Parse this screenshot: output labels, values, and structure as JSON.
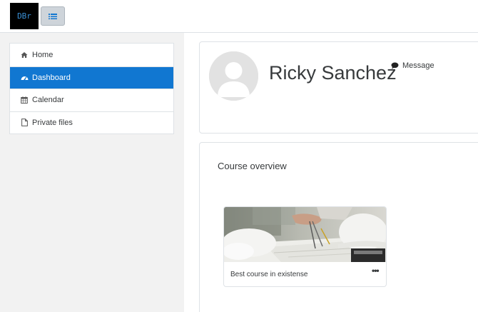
{
  "brand": {
    "logo_text": "DBr"
  },
  "sidebar": {
    "items": [
      {
        "label": "Home",
        "icon": "home-icon"
      },
      {
        "label": "Dashboard",
        "icon": "dashboard-icon",
        "active": true
      },
      {
        "label": "Calendar",
        "icon": "calendar-icon"
      },
      {
        "label": "Private files",
        "icon": "file-icon"
      }
    ]
  },
  "profile": {
    "name": "Ricky Sanchez",
    "message_label": "Message"
  },
  "overview": {
    "title": "Course overview",
    "courses": [
      {
        "name": "Best course in existense",
        "menu_label": "•••"
      }
    ]
  },
  "colors": {
    "accent": "#1177d1",
    "navbar_bg": "#ffffff",
    "page_bg": "#f2f2f2",
    "logo_bg": "#000000"
  }
}
